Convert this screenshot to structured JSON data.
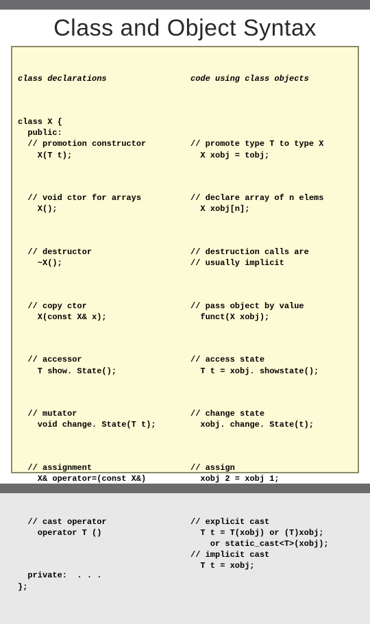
{
  "title": "Class and Object Syntax",
  "left": {
    "header": "class declarations",
    "b0": "class X {\n  public:\n  // promotion constructor\n    X(T t);",
    "b1": "  // void ctor for arrays\n    X();",
    "b2": "  // destructor\n    ~X();",
    "b3": "  // copy ctor\n    X(const X& x);",
    "b4": "  // accessor\n    T show. State();",
    "b5": "  // mutator\n    void change. State(T t);",
    "b6": "  // assignment\n    X& operator=(const X&)",
    "b7": "  // cast operator\n    operator T ()",
    "b8": "  private:  . . .\n};"
  },
  "right": {
    "header": "code using class objects",
    "b0": "\n\n// promote type T to type X\n  X xobj = tobj;",
    "b1": "// declare array of n elems\n  X xobj[n];",
    "b2": "// destruction calls are\n// usually implicit",
    "b3": "// pass object by value\n  funct(X xobj);",
    "b4": "// access state\n  T t = xobj. showstate();",
    "b5": "// change state\n  xobj. change. State(t);",
    "b6": "// assign\n  xobj 2 = xobj 1;",
    "b7": "// explicit cast\n  T t = T(xobj) or (T)xobj;\n    or static_cast<T>(xobj);\n// implicit cast\n  T t = xobj;"
  }
}
